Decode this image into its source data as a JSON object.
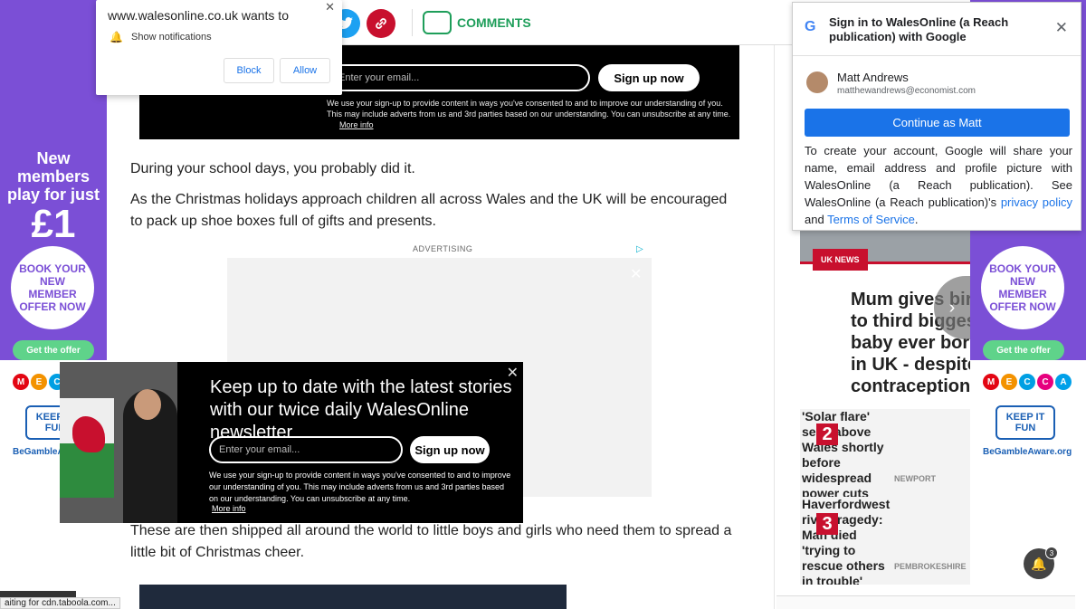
{
  "notification": {
    "site": "www.walesonline.co.uk wants to",
    "message": "Show notifications",
    "block": "Block",
    "allow": "Allow",
    "close": "✕"
  },
  "toolbar": {
    "comments_label": "COMMENTS"
  },
  "newsletter_top": {
    "email_placeholder": "Enter your email...",
    "signup": "Sign up now",
    "legal": "We use your sign-up to provide content in ways you've consented to and to improve our understanding of you. This may include adverts from us and 3rd parties based on our understanding. You can unsubscribe at any time.",
    "more_info": "More info"
  },
  "article": {
    "p1": "During your school days, you probably did it.",
    "p2": "As the Christmas holidays approach children all across Wales and the UK will be encouraged to pack up shoe boxes full of gifts and presents.",
    "advertising": "ADVERTISING",
    "p3": "These are then shipped all around the world to little boys and girls who need them to spread a little bit of Christmas cheer."
  },
  "newsletter_popup": {
    "headline": "Keep up to date with the latest stories with our twice daily WalesOnline newsletter",
    "email_placeholder": "Enter your email...",
    "signup": "Sign up now",
    "legal": "We use your sign-up to provide content in ways you've consented to and to improve our understanding of you. This may include adverts from us and 3rd parties based on our understanding. You can unsubscribe at any time.",
    "more_info": "More info",
    "close": "✕"
  },
  "side_ad": {
    "line1": "New members play for just",
    "price": "£1",
    "book": "BOOK YOUR NEW MEMBER OFFER NOW",
    "offer": "Get the offer",
    "keepit": "KEEP IT FUN",
    "gamble": "BeGambleAware.org"
  },
  "google_signin": {
    "title": "Sign in to WalesOnline (a Reach publication) with Google",
    "user_name": "Matt Andrews",
    "user_email": "matthewandrews@economist.com",
    "continue": "Continue as Matt",
    "disclosure_start": "To create your account, Google will share your name, email address and profile picture with WalesOnline (a Reach publication). See WalesOnline (a Reach publication)'s ",
    "privacy_policy": "privacy policy",
    "and": " and ",
    "terms": "Terms of Service",
    "end": "."
  },
  "news_card": {
    "tag": "UK NEWS",
    "title": "Mum gives birth to third biggest baby ever born in UK - despite contraception"
  },
  "trending": [
    {
      "num": "2",
      "text": "'Solar flare' seen above Wales shortly before widespread power cuts",
      "location": "NEWPORT"
    },
    {
      "num": "3",
      "text": "Haverfordwest river tragedy: Man died 'trying to rescue others in trouble' Power cut in",
      "location": "PEMBROKESHIRE"
    }
  ],
  "notification_badge": "3",
  "status": "aiting for cdn.taboola.com..."
}
